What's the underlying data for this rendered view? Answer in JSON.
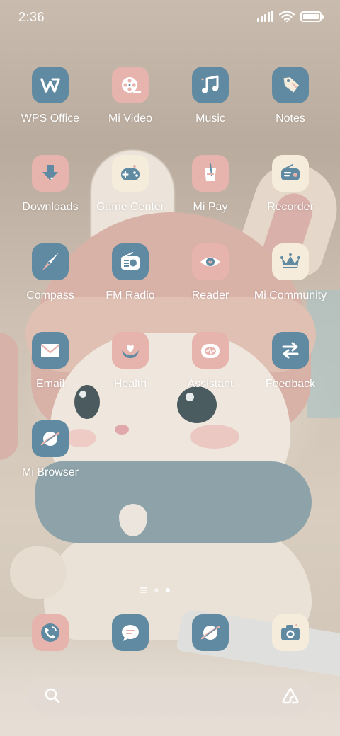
{
  "status_bar": {
    "time": "2:36",
    "signal_icon": "signal-icon",
    "wifi_icon": "wifi-icon",
    "battery_icon": "battery-icon",
    "battery_level": 1.0
  },
  "apps": [
    {
      "label": "WPS Office",
      "icon": "wps-office-icon",
      "color": "#5f8aa2"
    },
    {
      "label": "Mi Video",
      "icon": "film-reel-icon",
      "color": "#e6b3ad"
    },
    {
      "label": "Music",
      "icon": "music-note-icon",
      "color": "#5f8aa2"
    },
    {
      "label": "Notes",
      "icon": "tag-icon",
      "color": "#5f8aa2"
    },
    {
      "label": "Downloads",
      "icon": "download-arrow-icon",
      "color": "#e6b3ad"
    },
    {
      "label": "Game Center",
      "icon": "gamepad-icon",
      "color": "#f5ecdc"
    },
    {
      "label": "Mi Pay",
      "icon": "cup-icon",
      "color": "#e6b3ad"
    },
    {
      "label": "Recorder",
      "icon": "recorder-icon",
      "color": "#f5ecdc"
    },
    {
      "label": "Compass",
      "icon": "compass-needle-icon",
      "color": "#5f8aa2"
    },
    {
      "label": "FM Radio",
      "icon": "radio-icon",
      "color": "#5f8aa2"
    },
    {
      "label": "Reader",
      "icon": "eye-icon",
      "color": "#e6b3ad"
    },
    {
      "label": "Mi Community",
      "icon": "crown-icon",
      "color": "#f5ecdc"
    },
    {
      "label": "Email",
      "icon": "envelope-icon",
      "color": "#5f8aa2"
    },
    {
      "label": "Health",
      "icon": "heart-hands-icon",
      "color": "#e6b3ad"
    },
    {
      "label": "Assistant",
      "icon": "assistant-robot-icon",
      "color": "#e6b3ad"
    },
    {
      "label": "Feedback",
      "icon": "swap-arrows-icon",
      "color": "#5f8aa2"
    },
    {
      "label": "Mi Browser",
      "icon": "planet-icon",
      "color": "#5f8aa2"
    }
  ],
  "page_indicator": {
    "pages": 2,
    "current": 2
  },
  "dock": [
    {
      "icon": "phone-icon",
      "color": "#e6b3ad"
    },
    {
      "icon": "message-bubble-icon",
      "color": "#5f8aa2"
    },
    {
      "icon": "browser-planet-icon",
      "color": "#5f8aa2"
    },
    {
      "icon": "camera-icon",
      "color": "#f5ecdc"
    }
  ],
  "search_bar": {
    "search_icon": "search-icon",
    "assistant_icon": "assistant-logo-icon"
  }
}
